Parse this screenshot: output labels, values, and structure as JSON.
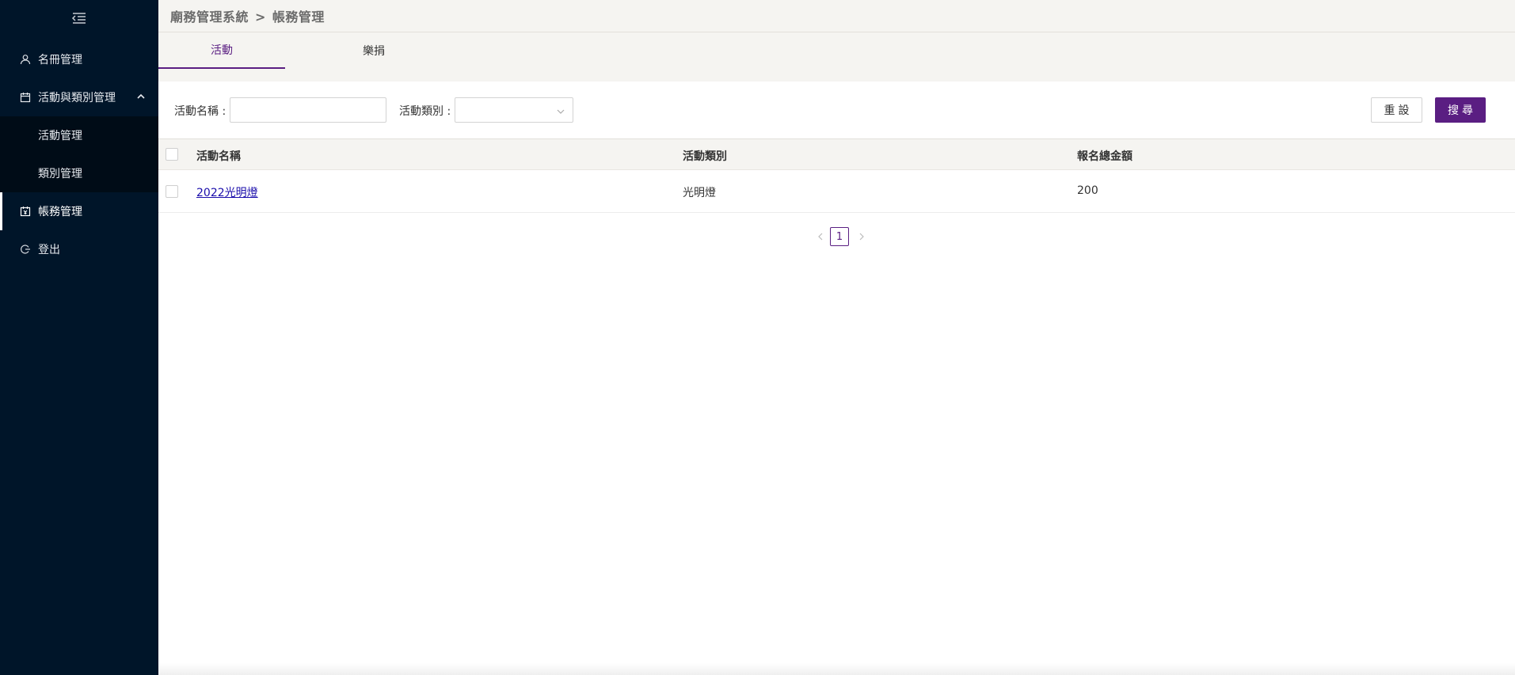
{
  "sidebar": {
    "items": [
      {
        "label": "名冊管理",
        "icon": "user-icon"
      },
      {
        "label": "活動與類別管理",
        "icon": "calendar-icon",
        "expanded": true
      },
      {
        "label": "活動管理"
      },
      {
        "label": "類別管理"
      },
      {
        "label": "帳務管理",
        "icon": "ledger-icon",
        "active": true
      },
      {
        "label": "登出",
        "icon": "logout-icon"
      }
    ]
  },
  "breadcrumb": {
    "root": "廟務管理系統",
    "separator": ">",
    "current": "帳務管理"
  },
  "tabs": [
    {
      "label": "活動",
      "active": true
    },
    {
      "label": "樂捐",
      "active": false
    }
  ],
  "filter": {
    "name_label": "活動名稱 :",
    "name_value": "",
    "category_label": "活動類別 :",
    "category_value": "",
    "reset_label": "重設",
    "search_label": "搜尋"
  },
  "table": {
    "columns": [
      "活動名稱",
      "活動類別",
      "報名總金額"
    ],
    "rows": [
      {
        "name": "2022光明燈",
        "category": "光明燈",
        "total": "200"
      }
    ]
  },
  "pagination": {
    "current_page": "1"
  },
  "colors": {
    "sidebar_bg": "#001529",
    "accent": "#5a1e82",
    "header_bg": "#f5f4f1"
  }
}
